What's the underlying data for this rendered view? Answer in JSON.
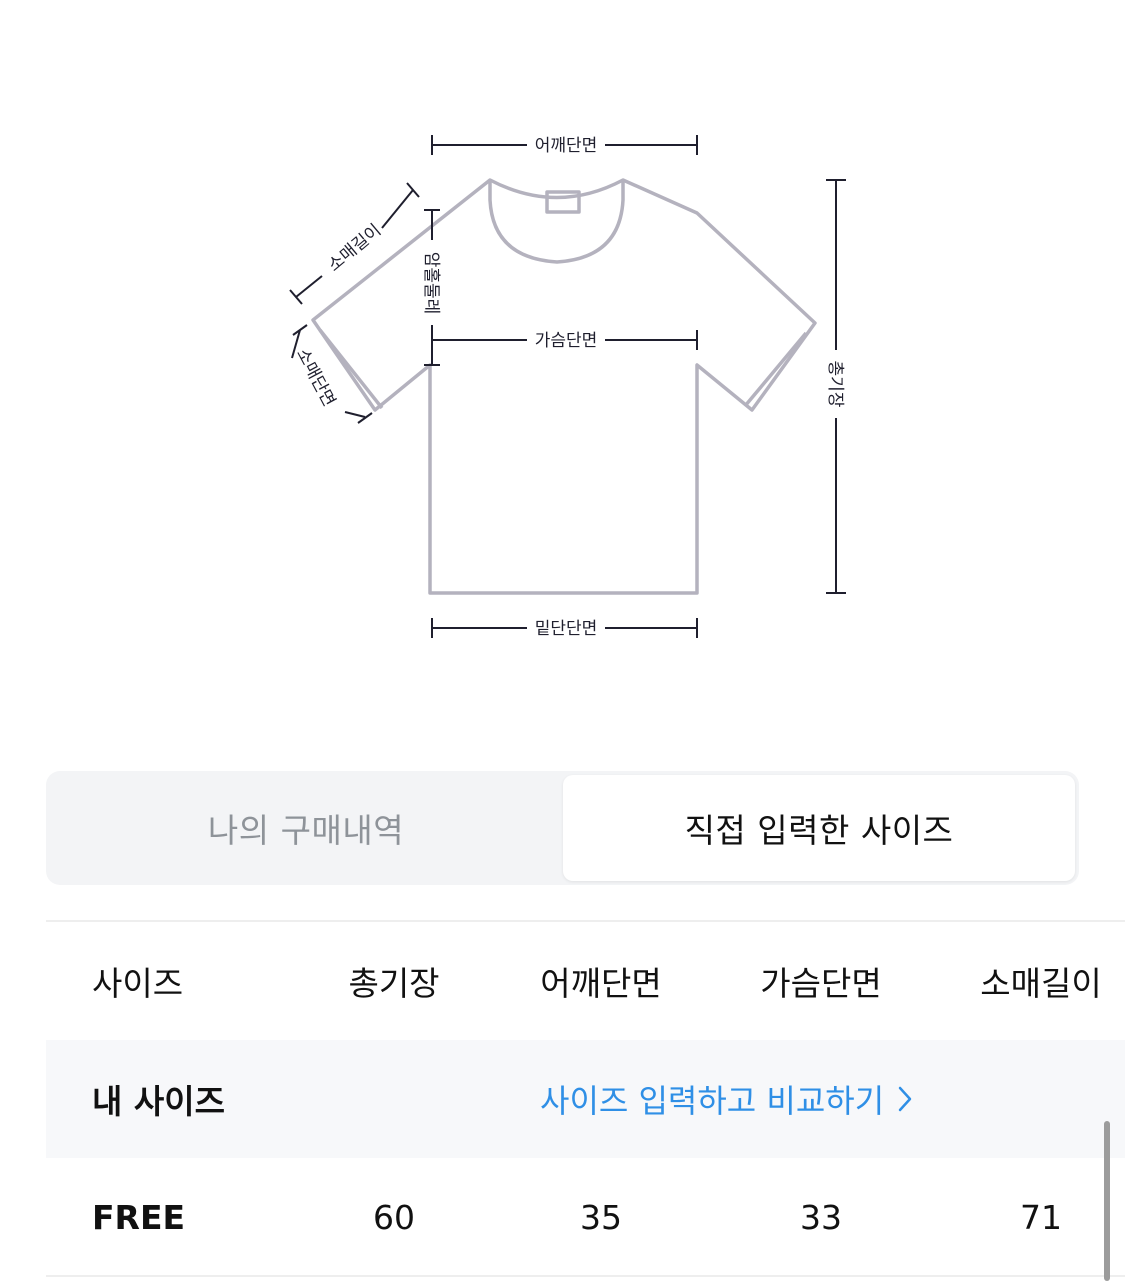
{
  "diagram": {
    "labels": {
      "shoulder": "어깨단면",
      "sleeve_length": "소매길이",
      "armhole": "암홀둘레",
      "chest": "가슴단면",
      "sleeve_opening": "소매단면",
      "total_length": "총기장",
      "hem": "밑단단면"
    },
    "colors": {
      "outline": "#b4b2be",
      "measure": "#1f1f2e"
    }
  },
  "tabs": {
    "left_label": "나의 구매내역",
    "right_label": "직접 입력한 사이즈",
    "active": "right"
  },
  "table": {
    "headers": [
      "사이즈",
      "총기장",
      "어깨단면",
      "가슴단면",
      "소매길이"
    ],
    "my_size": {
      "label": "내 사이즈",
      "link_text": "사이즈 입력하고 비교하기",
      "link_icon": "chevron-right-icon",
      "link_color": "#2f8fe6"
    },
    "rows": [
      {
        "size": "FREE",
        "values": [
          "60",
          "35",
          "33",
          "71"
        ]
      }
    ]
  }
}
